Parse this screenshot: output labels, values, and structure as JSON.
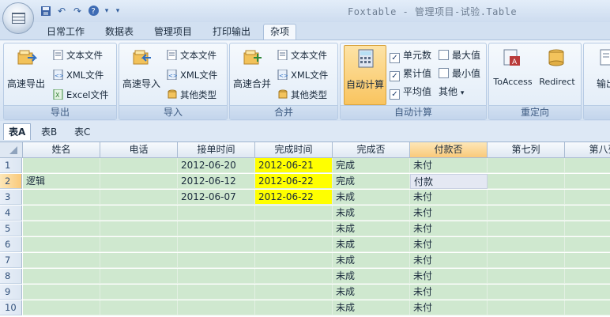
{
  "app": {
    "title": "Foxtable - 管理项目-试验.Table",
    "qat_icons": [
      "save-icon",
      "undo-icon",
      "redo-icon",
      "help-icon",
      "customize-icon"
    ]
  },
  "ribbon": {
    "tabs": [
      {
        "label": "日常工作",
        "active": false
      },
      {
        "label": "数据表",
        "active": false
      },
      {
        "label": "管理项目",
        "active": false
      },
      {
        "label": "打印输出",
        "active": false
      },
      {
        "label": "杂项",
        "active": true
      }
    ],
    "groups": {
      "export": {
        "label": "导出",
        "big": "高速导出",
        "items": [
          "文本文件",
          "XML文件",
          "Excel文件"
        ]
      },
      "import": {
        "label": "导入",
        "big": "高速导入",
        "items": [
          "文本文件",
          "XML文件",
          "其他类型"
        ]
      },
      "merge": {
        "label": "合并",
        "big": "高速合并",
        "items": [
          "文本文件",
          "XML文件",
          "其他类型"
        ]
      },
      "autocalc": {
        "label": "自动计算",
        "big": "自动计算",
        "checks": [
          {
            "label": "单元数",
            "checked": true
          },
          {
            "label": "累计值",
            "checked": true
          },
          {
            "label": "平均值",
            "checked": true
          },
          {
            "label": "最大值",
            "checked": false
          },
          {
            "label": "最小值",
            "checked": false
          }
        ],
        "other": "其他"
      },
      "redirect": {
        "label": "重定向",
        "items": [
          "ToAccess",
          "Redirect"
        ]
      },
      "extra": {
        "label": "输出"
      }
    }
  },
  "sheets": [
    {
      "label": "表A",
      "active": true
    },
    {
      "label": "表B",
      "active": false
    },
    {
      "label": "表C",
      "active": false
    }
  ],
  "grid": {
    "columns": [
      "姓名",
      "电话",
      "接单时间",
      "完成时间",
      "完成否",
      "付款否",
      "第七列",
      "第八列"
    ],
    "rows": [
      {
        "num": "1",
        "cells": [
          "",
          "",
          "2012-06-20",
          "2012-06-21",
          "完成",
          "未付",
          "",
          ""
        ]
      },
      {
        "num": "2",
        "cells": [
          "逻辑",
          "",
          "2012-06-12",
          "2012-06-22",
          "完成",
          "付款",
          "",
          ""
        ]
      },
      {
        "num": "3",
        "cells": [
          "",
          "",
          "2012-06-07",
          "2012-06-22",
          "未成",
          "未付",
          "",
          ""
        ]
      },
      {
        "num": "4",
        "cells": [
          "",
          "",
          "",
          "",
          "未成",
          "未付",
          "",
          ""
        ]
      },
      {
        "num": "5",
        "cells": [
          "",
          "",
          "",
          "",
          "未成",
          "未付",
          "",
          ""
        ]
      },
      {
        "num": "6",
        "cells": [
          "",
          "",
          "",
          "",
          "未成",
          "未付",
          "",
          ""
        ]
      },
      {
        "num": "7",
        "cells": [
          "",
          "",
          "",
          "",
          "未成",
          "未付",
          "",
          ""
        ]
      },
      {
        "num": "8",
        "cells": [
          "",
          "",
          "",
          "",
          "未成",
          "未付",
          "",
          ""
        ]
      },
      {
        "num": "9",
        "cells": [
          "",
          "",
          "",
          "",
          "未成",
          "未付",
          "",
          ""
        ]
      },
      {
        "num": "10",
        "cells": [
          "",
          "",
          "",
          "",
          "未成",
          "未付",
          "",
          ""
        ]
      }
    ]
  },
  "colors": {
    "cell_fill": "#cfe8cf",
    "highlight": "#ffff00",
    "selected_header": "#f9c97a"
  }
}
